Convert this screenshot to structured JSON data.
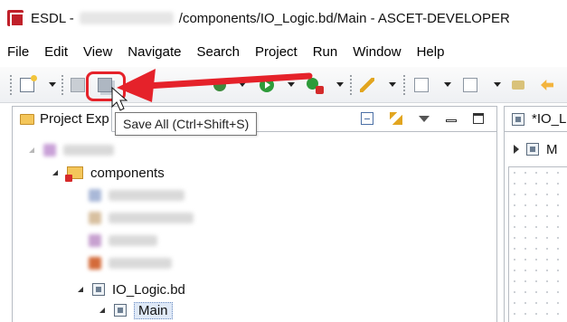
{
  "window": {
    "title_prefix": "ESDL -",
    "title_suffix": "/components/IO_Logic.bd/Main - ASCET-DEVELOPER"
  },
  "menu": [
    "File",
    "Edit",
    "View",
    "Navigate",
    "Search",
    "Project",
    "Run",
    "Window",
    "Help"
  ],
  "tooltip": {
    "text": "Save All (Ctrl+Shift+S)"
  },
  "project_explorer": {
    "tab_label": "Project Exp"
  },
  "tree": {
    "components": "components",
    "io_logic": "IO_Logic.bd",
    "main": "Main"
  },
  "editor": {
    "tab_label": "*IO_L",
    "row_label": "M"
  },
  "colors": {
    "highlight": "#e5222a",
    "arrow": "#e5222a"
  },
  "icons": {
    "app": "esdl-app-icon",
    "save_all": "save-all-icon"
  }
}
